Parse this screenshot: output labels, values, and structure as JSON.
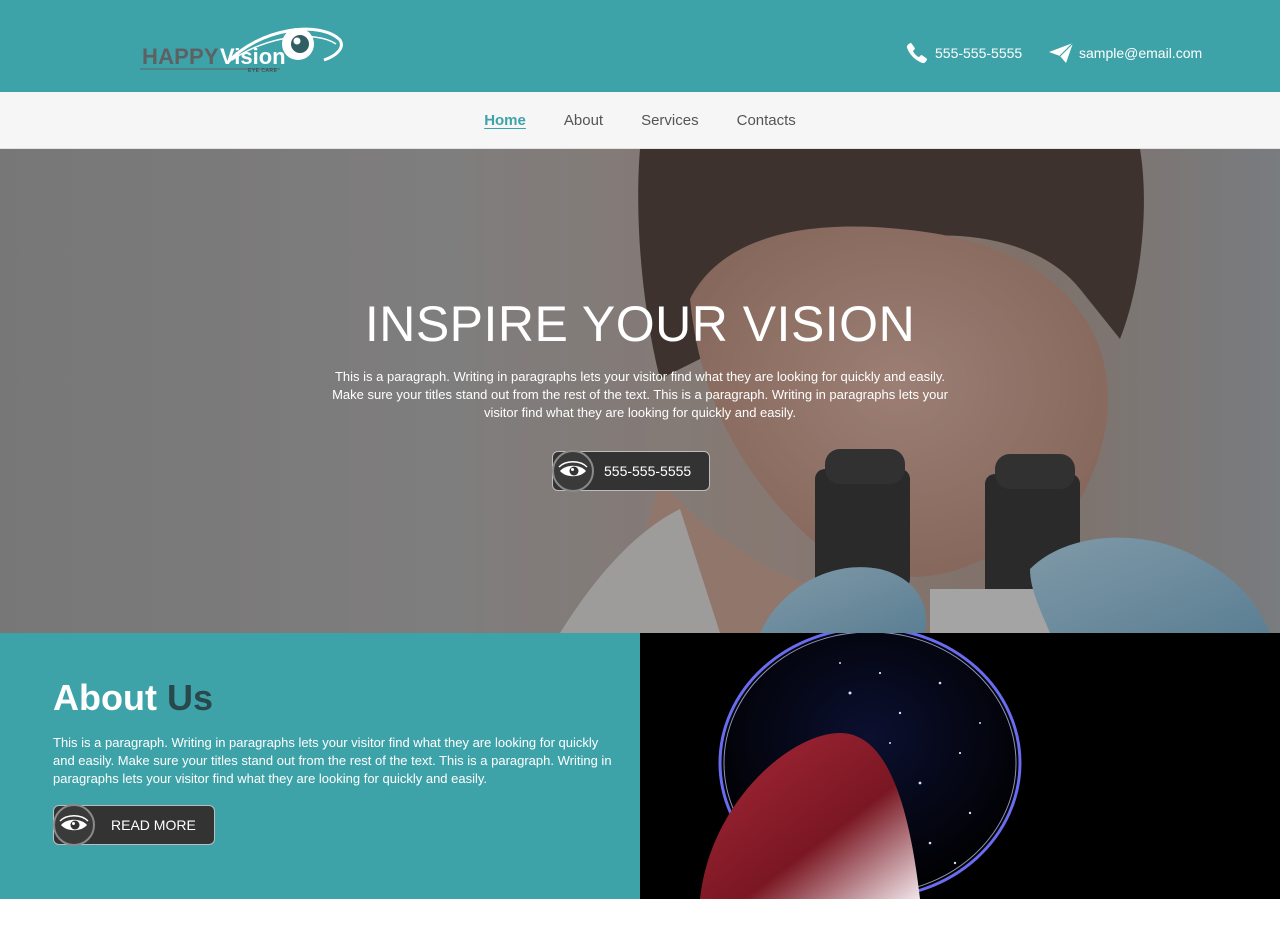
{
  "header": {
    "logo": {
      "word1": "HAPPY",
      "word2": "Vision",
      "tagline": "EYE CARE"
    },
    "phone": "555-555-5555",
    "email": "sample@email.com",
    "icons": {
      "phone": "phone-icon",
      "email": "paper-plane-icon"
    }
  },
  "nav": {
    "items": [
      {
        "label": "Home",
        "active": true
      },
      {
        "label": "About",
        "active": false
      },
      {
        "label": "Services",
        "active": false
      },
      {
        "label": "Contacts",
        "active": false
      }
    ]
  },
  "hero": {
    "title": "INSPIRE YOUR VISION",
    "paragraph": "This is a paragraph. Writing in paragraphs lets your visitor find what they are looking for quickly and easily. Make sure your titles stand out from the rest of the text. This is a paragraph. Writing in paragraphs lets your visitor find what they are looking for quickly and easily.",
    "button_label": "555-555-5555",
    "button_icon": "eye-icon"
  },
  "about": {
    "title_part1": "About",
    "title_part2": "Us",
    "paragraph": "This is a paragraph. Writing in paragraphs lets your visitor find what they are looking for quickly and easily. Make sure your titles stand out from the rest of the text. This is a paragraph. Writing in paragraphs lets your visitor find what they are looking for quickly and easily.",
    "button_label": "READ MORE",
    "button_icon": "eye-icon"
  },
  "colors": {
    "brand_teal": "#3ea3a9",
    "nav_bg": "#f6f6f6",
    "dark_button": "#333333",
    "accent_dark": "#28484b"
  }
}
